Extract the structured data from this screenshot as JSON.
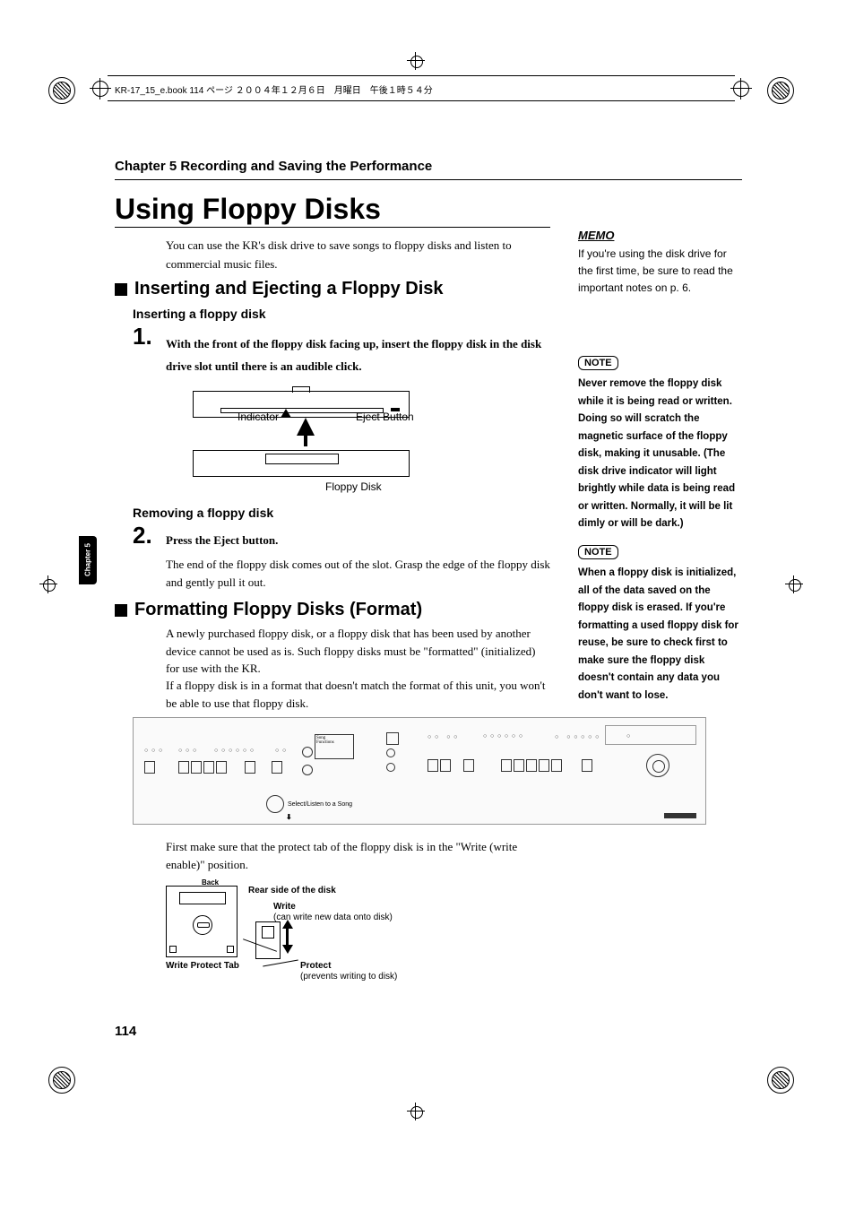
{
  "header_line": "KR-17_15_e.book  114 ページ  ２００４年１２月６日　月曜日　午後１時５４分",
  "chapter_heading": "Chapter 5 Recording and Saving the Performance",
  "main_title": "Using Floppy Disks",
  "intro": "You can use the KR's disk drive to save songs to floppy disks and listen to commercial music files.",
  "section1_title": "Inserting and Ejecting a Floppy Disk",
  "sub_insert": "Inserting a floppy disk",
  "step1_num": "1.",
  "step1_text": "With the front of the floppy disk facing up, insert the floppy disk in the disk drive slot until there is an audible click.",
  "fig1": {
    "indicator": "Indicator",
    "eject": "Eject Button",
    "floppy": "Floppy Disk"
  },
  "sub_remove": "Removing a floppy disk",
  "step2_num": "2.",
  "step2_text": "Press the Eject button.",
  "step2_follow": "The end of the floppy disk comes out of the slot. Grasp the edge of the floppy disk and gently pull it out.",
  "section2_title": "Formatting Floppy Disks (Format)",
  "format_p1": "A newly purchased floppy disk, or a floppy disk that has been used by another device cannot be used as is. Such floppy disks must be \"formatted\" (initialized) for use with the KR.",
  "format_p2": "If a floppy disk is in a format that doesn't match the format of this unit, you won't be able to use that floppy disk.",
  "panel_select": "Select/Listen to a Song",
  "firstmake": "First make sure that the protect tab of the floppy disk is in the \"Write (write enable)\" position.",
  "fig2": {
    "back": "Back",
    "rear": "Rear side of the disk",
    "write": "Write",
    "write_sub": "(can write new data onto disk)",
    "wpt": "Write Protect Tab",
    "protect": "Protect",
    "protect_sub": "(prevents writing to disk)"
  },
  "memo_label": "MEMO",
  "memo_text": "If you're using the disk drive for the first time, be sure to read the important notes on p. 6.",
  "note_label": "NOTE",
  "note1_text": "Never remove the floppy disk while it is being read or written. Doing so will scratch the magnetic surface of the floppy disk, making it unusable. (The disk drive indicator will light brightly while data is being read or written. Normally, it will be lit dimly or will be dark.)",
  "note2_text": "When a floppy disk is initialized, all of the data saved on the floppy disk is erased. If you're formatting a used floppy disk for reuse, be sure to check first to make sure the floppy disk doesn't contain any data you don't want to lose.",
  "side_tab": "Chapter 5",
  "page_number": "114"
}
